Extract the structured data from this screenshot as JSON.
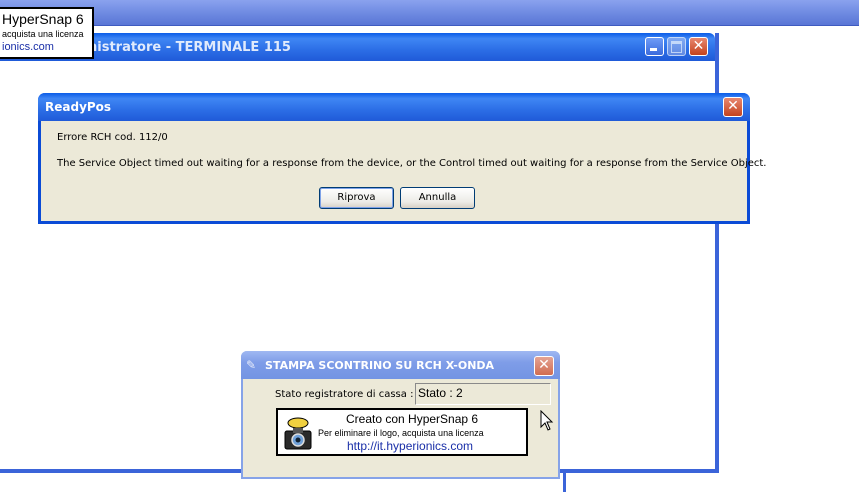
{
  "taskbar": {},
  "hypersnap_watermark_top": {
    "line1": "HyperSnap 6",
    "line2": "acquista una licenza",
    "line3": "ionics.com"
  },
  "main_window": {
    "title": "nistratore - TERMINALE 115"
  },
  "readypos_dialog": {
    "title": "ReadyPos",
    "error_code": "Errore RCH cod. 112/0",
    "message": "The Service Object timed out waiting for a response from the device, or the Control timed out waiting for a response from the Service Object.",
    "retry_label": "Riprova",
    "cancel_label": "Annulla"
  },
  "stampa_dialog": {
    "title": "STAMPA SCONTRINO SU RCH X-ONDA",
    "status_label": "Stato registratore di cassa :",
    "status_value": "Stato : 2",
    "watermark": {
      "line1": "Creato con HyperSnap 6",
      "line2": "Per eliminare il logo, acquista una licenza",
      "line3": "http://it.hyperionics.com"
    }
  },
  "colors": {
    "titlebar_blue": "#2c6ee6",
    "dialog_bg": "#ece9d8",
    "close_red": "#c4431e",
    "link_blue": "#1a2fa8"
  }
}
